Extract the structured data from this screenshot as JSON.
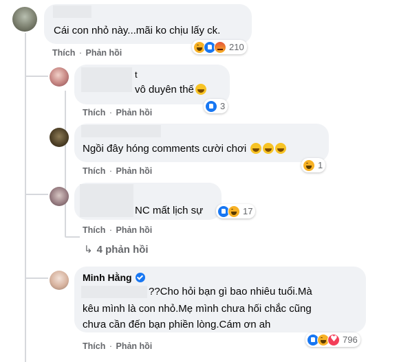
{
  "comments": [
    {
      "text": "Cái con nhỏ này...mãi ko chịu lấy ck.",
      "actions": {
        "like": "Thích",
        "sep": "·",
        "reply": "Phản hồi"
      },
      "reactions": [
        "haha",
        "like",
        "angry"
      ],
      "reaction_count": "210"
    },
    {
      "name_fragment": "t",
      "text": "vô duyên thế",
      "actions": {
        "like": "Thích",
        "sep": "·",
        "reply": "Phản hồi"
      },
      "reactions": [
        "like"
      ],
      "reaction_count": "3"
    },
    {
      "text": "Ngồi đây hóng comments cười chơi",
      "actions": {
        "like": "Thích",
        "sep": "·",
        "reply": "Phản hồi"
      },
      "reactions": [
        "haha"
      ],
      "reaction_count": "1"
    },
    {
      "text": "NC mất lịch sự",
      "actions": {
        "like": "Thích",
        "sep": "·",
        "reply": "Phản hồi"
      },
      "reactions": [
        "like",
        "haha"
      ],
      "reaction_count": "17"
    },
    {
      "author": "Minh Hằng",
      "text_lines": [
        "??Cho hỏi bạn gì bao nhiêu tuổi.Mà",
        "kêu mình là con nhỏ.Mẹ mình chưa hối chắc cũng",
        "chưa cần đến bạn phiền lòng.Cám ơn ah"
      ],
      "actions": {
        "like": "Thích",
        "sep": "·",
        "reply": "Phản hồi"
      },
      "reactions": [
        "like",
        "haha",
        "love"
      ],
      "reaction_count": "796"
    }
  ],
  "replies_link": {
    "icon": "reply-arrow-icon",
    "label": "4 phản hồi"
  },
  "colors": {
    "bubble": "#f0f2f5",
    "meta": "#65676b",
    "like": "#1877f2"
  }
}
